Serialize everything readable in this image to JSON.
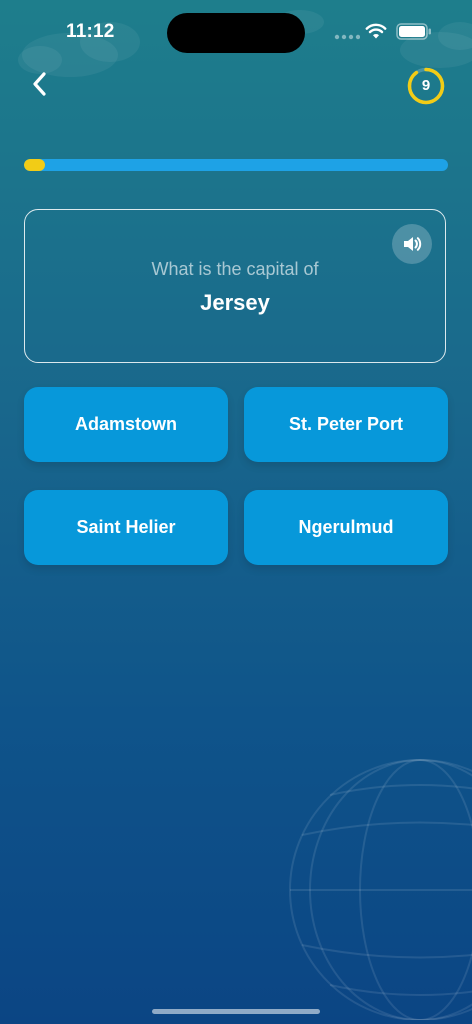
{
  "status_bar": {
    "time": "11:12",
    "icons": [
      "signal-dots-icon",
      "wifi-icon",
      "battery-icon"
    ]
  },
  "header": {
    "back_icon": "chevron-left-icon",
    "timer_value": "9",
    "timer_ring_fraction": 0.9,
    "timer_color": "#f2cc16"
  },
  "progress": {
    "fraction": 0.05,
    "fill_color": "#f2cc16",
    "track_color": "#1ea2e6"
  },
  "question": {
    "prompt": "What is the capital of",
    "subject": "Jersey",
    "sound_icon": "speaker-icon"
  },
  "answers": [
    {
      "label": "Adamstown"
    },
    {
      "label": "St. Peter Port"
    },
    {
      "label": "Saint Helier"
    },
    {
      "label": "Ngerulmud"
    }
  ],
  "colors": {
    "background_top": "#1e7e8c",
    "background_bottom": "#0b4584",
    "answer_button": "#0798da"
  }
}
